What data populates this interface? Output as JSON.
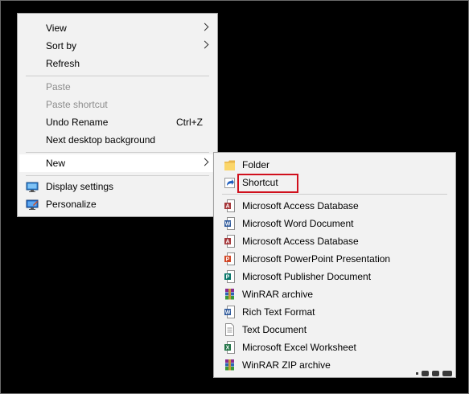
{
  "context_menu": {
    "items": [
      {
        "label": "View"
      },
      {
        "label": "Sort by"
      },
      {
        "label": "Refresh"
      },
      {
        "label": "Paste"
      },
      {
        "label": "Paste shortcut"
      },
      {
        "label": "Undo Rename",
        "shortcut": "Ctrl+Z"
      },
      {
        "label": "Next desktop background"
      },
      {
        "label": "New"
      },
      {
        "label": "Display settings",
        "icon": "display-icon"
      },
      {
        "label": "Personalize",
        "icon": "personalize-icon"
      }
    ]
  },
  "new_submenu": {
    "items": [
      {
        "label": "Folder",
        "icon": "folder-icon"
      },
      {
        "label": "Shortcut",
        "icon": "shortcut-icon",
        "highlighted": true
      },
      {
        "label": "Microsoft Access Database",
        "icon": "access-icon"
      },
      {
        "label": "Microsoft Word Document",
        "icon": "word-icon"
      },
      {
        "label": "Microsoft Access Database",
        "icon": "access-icon"
      },
      {
        "label": "Microsoft PowerPoint Presentation",
        "icon": "powerpoint-icon"
      },
      {
        "label": "Microsoft Publisher Document",
        "icon": "publisher-icon"
      },
      {
        "label": "WinRAR archive",
        "icon": "winrar-icon"
      },
      {
        "label": "Rich Text Format",
        "icon": "rtf-icon"
      },
      {
        "label": "Text Document",
        "icon": "text-document-icon"
      },
      {
        "label": "Microsoft Excel Worksheet",
        "icon": "excel-icon"
      },
      {
        "label": "WinRAR ZIP archive",
        "icon": "winrar-zip-icon"
      }
    ]
  },
  "colors": {
    "menu_bg": "#f2f2f2",
    "hover_bg": "#ffffff",
    "disabled_text": "#8c8c8c",
    "highlight_box": "#d0101d",
    "desktop_bg": "#000000"
  }
}
